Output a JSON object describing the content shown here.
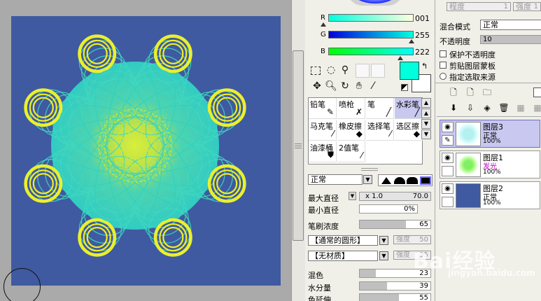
{
  "color": {
    "r_label": "R",
    "g_label": "G",
    "b_label": "B",
    "r_value": "001",
    "g_value": "255",
    "b_value": "222",
    "r_fraction": 0.004,
    "g_fraction": 1.0,
    "b_fraction": 0.87,
    "primary_color": "#01ffde",
    "secondary_color": "#ffffff"
  },
  "tools": [
    "select-rect-icon",
    "lasso-icon",
    "magic-wand-icon",
    "move-icon",
    "zoom-icon",
    "rotate-icon",
    "hand-icon",
    "eyedropper-icon"
  ],
  "brushes": [
    {
      "label": "铅笔",
      "icon": "pencil-icon"
    },
    {
      "label": "喷枪",
      "icon": "airbrush-icon"
    },
    {
      "label": "笔",
      "icon": "pen-icon"
    },
    {
      "label": "水彩笔",
      "icon": "watercolor-icon"
    },
    {
      "label": "马克笔",
      "icon": "marker-icon"
    },
    {
      "label": "橡皮擦",
      "icon": "eraser-icon"
    },
    {
      "label": "选择笔",
      "icon": "select-pen-icon"
    },
    {
      "label": "选区擦",
      "icon": "select-eraser-icon"
    },
    {
      "label": "油漆桶",
      "icon": "bucket-icon"
    },
    {
      "label": "2值笔",
      "icon": "binary-pen-icon"
    }
  ],
  "brush_mode": "正常",
  "props": {
    "max_size_label": "最大直径",
    "max_size_mult": "x 1.0",
    "max_size_value": "70.0",
    "min_size_label": "最小直径",
    "min_size_value": "0%",
    "min_size_fraction": 0.0,
    "density_label": "笔刷浓度",
    "density_value": "65",
    "density_fraction": 0.65,
    "shape_select": "【通常的圆形】",
    "shape_strength_label": "强度",
    "shape_strength_value": "50",
    "texture_select": "【无材质】",
    "texture_strength_label": "强度",
    "texture_strength_value": "95",
    "blend_label": "混色",
    "blend_value": "23",
    "blend_fraction": 0.23,
    "water_label": "水分量",
    "water_value": "39",
    "water_fraction": 0.39,
    "persist_label": "色延伸",
    "persist_value": "55",
    "persist_fraction": 0.55
  },
  "layer_panel": {
    "degree_label_1": "程度",
    "degree_value_1": "1",
    "degree_label_2": "强度",
    "degree_value_2": "1",
    "blend_mode_label": "混合模式",
    "blend_mode_value": "正常",
    "opacity_label": "不透明度",
    "opacity_value": "10",
    "protect_opacity": "保护不透明度",
    "clip_mask": "剪贴图层蒙板",
    "select_source": "指定选取来源"
  },
  "layers": [
    {
      "name": "图层3",
      "mode": "正常",
      "opacity": "100%",
      "selected": true
    },
    {
      "name": "图层1",
      "mode": "发光",
      "opacity": "100%",
      "selected": false
    },
    {
      "name": "图层2",
      "mode": "正常",
      "opacity": "100%",
      "selected": false
    }
  ],
  "canvas_colors": {
    "background": "#3f5aa0",
    "line": "#40e0c0",
    "ring": "#f0f020"
  },
  "watermark": {
    "main": "Bai经验",
    "sub": "jingyan.baidu.com"
  }
}
